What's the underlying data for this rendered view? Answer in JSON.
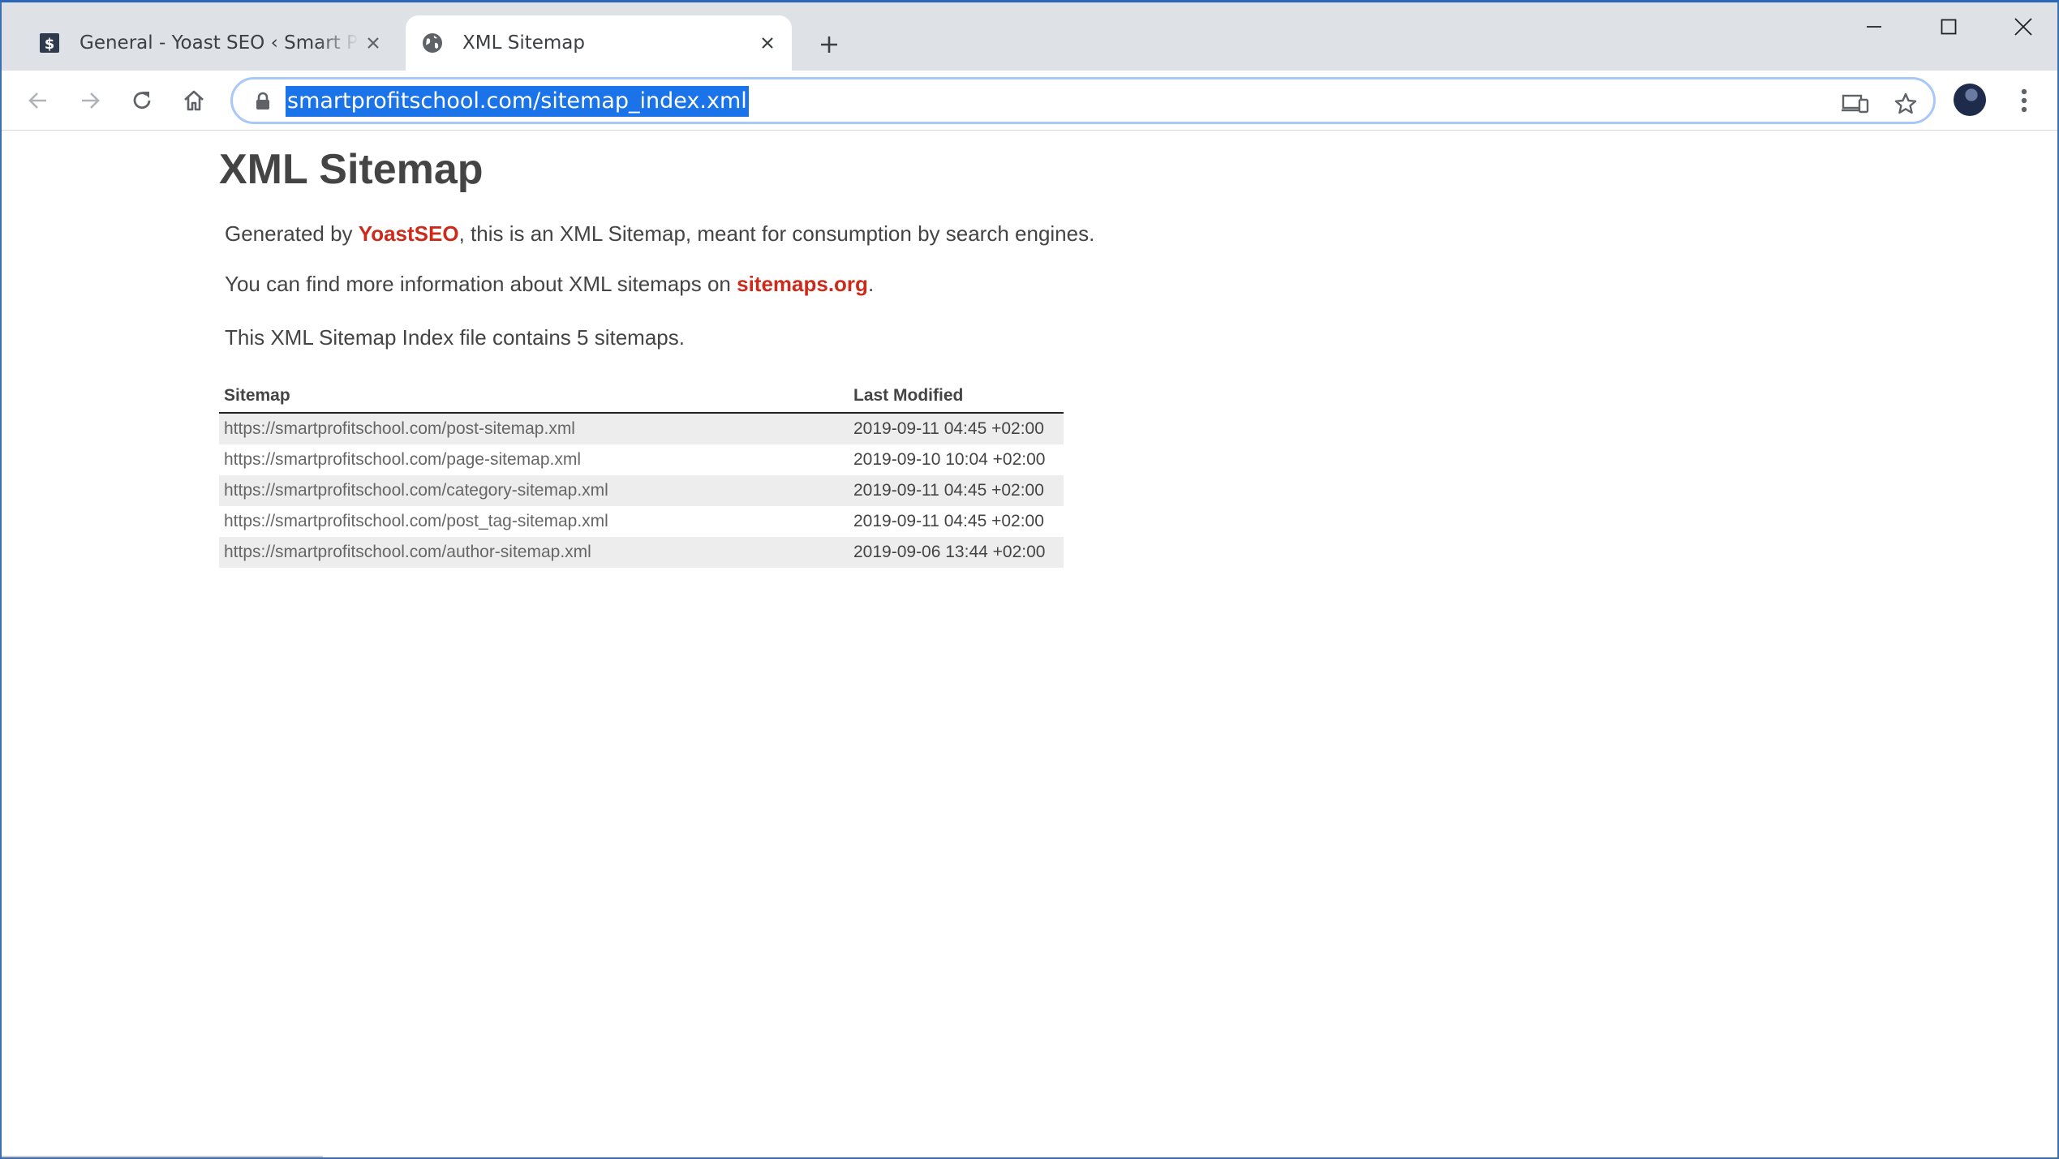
{
  "browser": {
    "tabs": [
      {
        "title": "General - Yoast SEO ‹ Smart Profit School",
        "active": false,
        "favicon": "dollar-favicon-icon"
      },
      {
        "title": "XML Sitemap",
        "active": true,
        "favicon": "globe-icon"
      }
    ],
    "address": "smartprofitschool.com/sitemap_index.xml",
    "accent": "#1a73e8"
  },
  "page": {
    "title": "XML Sitemap",
    "intro": {
      "prefix": "Generated by ",
      "link": "YoastSEO",
      "suffix": ", this is an XML Sitemap, meant for consumption by search engines."
    },
    "info": {
      "prefix": "You can find more information about XML sitemaps on ",
      "link": "sitemaps.org",
      "suffix": "."
    },
    "count_text": "This XML Sitemap Index file contains 5 sitemaps.",
    "table": {
      "headers": [
        "Sitemap",
        "Last Modified"
      ],
      "rows": [
        {
          "loc": "https://smartprofitschool.com/post-sitemap.xml",
          "mod": "2019-09-11 04:45 +02:00"
        },
        {
          "loc": "https://smartprofitschool.com/page-sitemap.xml",
          "mod": "2019-09-10 10:04 +02:00"
        },
        {
          "loc": "https://smartprofitschool.com/category-sitemap.xml",
          "mod": "2019-09-11 04:45 +02:00"
        },
        {
          "loc": "https://smartprofitschool.com/post_tag-sitemap.xml",
          "mod": "2019-09-11 04:45 +02:00"
        },
        {
          "loc": "https://smartprofitschool.com/author-sitemap.xml",
          "mod": "2019-09-06 13:44 +02:00"
        }
      ]
    },
    "link_color": "#cc2b1c"
  }
}
